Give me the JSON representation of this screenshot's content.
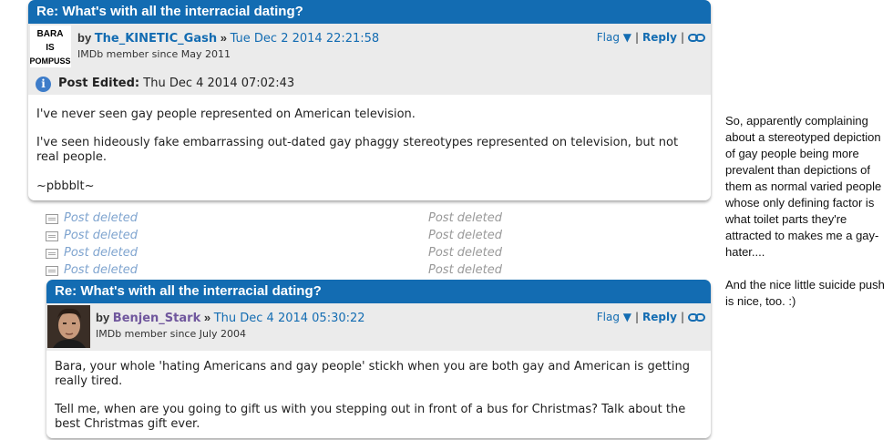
{
  "post1": {
    "title": "Re: What's with all the interracial dating?",
    "by": "by",
    "username": "The_KINETIC_Gash",
    "sep": "»",
    "date": "Tue Dec 2 2014 22:21:58",
    "member_since": "IMDb member since May 2011",
    "avatar_text": [
      "BARA",
      "IS",
      "POMPUSS"
    ],
    "flag": "Flag ▼",
    "reply": "Reply",
    "edited_label": "Post Edited:",
    "edited_date": "Thu Dec 4 2014 07:02:43",
    "body": [
      "I've never seen gay people represented on American television.",
      "I've seen hideously fake embarrassing out-dated gay phaggy stereotypes represented on television, but not real people.",
      "~pbbblt~"
    ]
  },
  "deleted": [
    {
      "left": "Post deleted",
      "right": "Post deleted"
    },
    {
      "left": "Post deleted",
      "right": "Post deleted"
    },
    {
      "left": "Post deleted",
      "right": "Post deleted"
    },
    {
      "left": "Post deleted",
      "right": "Post deleted"
    }
  ],
  "post2": {
    "title": "Re: What's with all the interracial dating?",
    "by": "by",
    "username": "Benjen_Stark",
    "sep": "»",
    "date": "Thu Dec 4 2014 05:30:22",
    "member_since": "IMDb member since July 2004",
    "flag": "Flag ▼",
    "reply": "Reply",
    "body": [
      "Bara, your whole 'hating Americans and gay people' stickh when you are both gay and American is getting really tired.",
      "Tell me, when are you going to gift us with you stepping out in front of a bus for Christmas? Talk about the best Christmas gift ever."
    ]
  },
  "note": [
    "So, apparently complaining about a stereotyped depiction of gay people being more prevalent than depictions of them as normal varied people whose only defining factor is what toilet parts they're attracted to makes me a gay-hater....",
    "And the nice little suicide push is nice, too. :)"
  ],
  "colors": {
    "title_bar": "#136cb2",
    "link": "#136cb2",
    "username_alt": "#70579d",
    "post_bg": "#ebebeb",
    "deleted_link": "#7fa4cf"
  }
}
